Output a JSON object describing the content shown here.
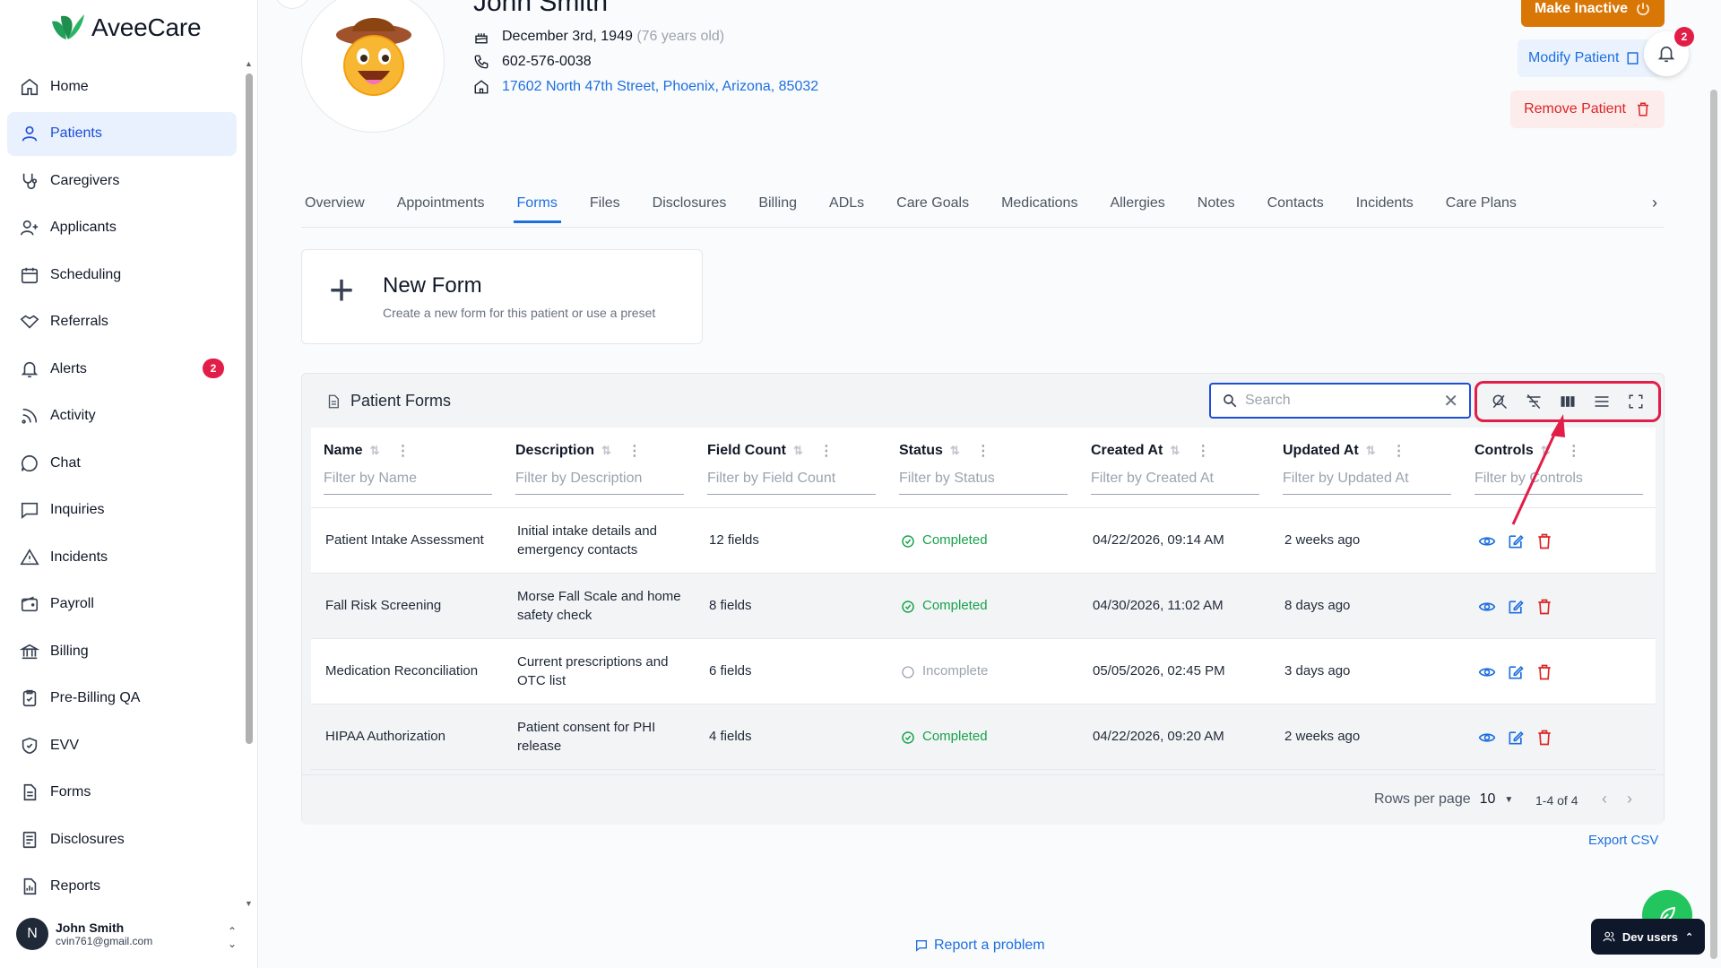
{
  "app": {
    "name": "AveeCare"
  },
  "sidebar": {
    "items": [
      {
        "label": "Home",
        "icon": "home-icon"
      },
      {
        "label": "Patients",
        "icon": "user-icon",
        "active": true
      },
      {
        "label": "Caregivers",
        "icon": "stethoscope-icon"
      },
      {
        "label": "Applicants",
        "icon": "user-plus-icon"
      },
      {
        "label": "Scheduling",
        "icon": "calendar-icon"
      },
      {
        "label": "Referrals",
        "icon": "handshake-icon"
      },
      {
        "label": "Alerts",
        "icon": "bell-icon",
        "badge": "2"
      },
      {
        "label": "Activity",
        "icon": "rss-icon"
      },
      {
        "label": "Chat",
        "icon": "chat-icon"
      },
      {
        "label": "Inquiries",
        "icon": "message-square-icon"
      },
      {
        "label": "Incidents",
        "icon": "warning-icon"
      },
      {
        "label": "Payroll",
        "icon": "wallet-icon"
      },
      {
        "label": "Billing",
        "icon": "bank-icon"
      },
      {
        "label": "Pre-Billing QA",
        "icon": "clipboard-check-icon"
      },
      {
        "label": "EVV",
        "icon": "shield-check-icon"
      },
      {
        "label": "Forms",
        "icon": "document-icon"
      },
      {
        "label": "Disclosures",
        "icon": "document-list-icon"
      },
      {
        "label": "Reports",
        "icon": "report-icon"
      }
    ],
    "user": {
      "initial": "N",
      "name": "John Smith",
      "email": "cvin761@gmail.com"
    }
  },
  "patient": {
    "name": "John Smith",
    "dob": "December 3rd, 1949",
    "age": "(76 years old)",
    "phone": "602-576-0038",
    "address": "17602 North 47th Street, Phoenix, Arizona, 85032"
  },
  "actions": {
    "make_inactive": "Make Inactive",
    "modify": "Modify Patient",
    "remove": "Remove Patient",
    "notifications_badge": "2"
  },
  "tabs": [
    "Overview",
    "Appointments",
    "Forms",
    "Files",
    "Disclosures",
    "Billing",
    "ADLs",
    "Care Goals",
    "Medications",
    "Allergies",
    "Notes",
    "Contacts",
    "Incidents",
    "Care Plans"
  ],
  "active_tab": "Forms",
  "new_form": {
    "title": "New Form",
    "subtitle": "Create a new form for this patient or use a preset"
  },
  "forms_table": {
    "title": "Patient Forms",
    "search_placeholder": "Search",
    "columns": [
      {
        "label": "Name",
        "filter": "Filter by Name"
      },
      {
        "label": "Description",
        "filter": "Filter by Description"
      },
      {
        "label": "Field Count",
        "filter": "Filter by Field Count"
      },
      {
        "label": "Status",
        "filter": "Filter by Status"
      },
      {
        "label": "Created At",
        "filter": "Filter by Created At"
      },
      {
        "label": "Updated At",
        "filter": "Filter by Updated At"
      },
      {
        "label": "Controls",
        "filter": "Filter by Controls"
      }
    ],
    "rows": [
      {
        "name": "Patient Intake Assessment",
        "description": "Initial intake details and emergency contacts",
        "fields": "12 fields",
        "status": "Completed",
        "created": "04/22/2026, 09:14 AM",
        "updated": "2 weeks ago"
      },
      {
        "name": "Fall Risk Screening",
        "description": "Morse Fall Scale and home safety check",
        "fields": "8 fields",
        "status": "Completed",
        "created": "04/30/2026, 11:02 AM",
        "updated": "8 days ago"
      },
      {
        "name": "Medication Reconciliation",
        "description": "Current prescriptions and OTC list",
        "fields": "6 fields",
        "status": "Incomplete",
        "created": "05/05/2026, 02:45 PM",
        "updated": "3 days ago"
      },
      {
        "name": "HIPAA Authorization",
        "description": "Patient consent for PHI release",
        "fields": "4 fields",
        "status": "Completed",
        "created": "04/22/2026, 09:20 AM",
        "updated": "2 weeks ago"
      }
    ],
    "rows_per_page_label": "Rows per page",
    "rows_per_page": "10",
    "range": "1-4 of 4",
    "export": "Export CSV"
  },
  "footer": {
    "report": "Report a problem",
    "dev_users": "Dev users"
  },
  "colors": {
    "primary": "#1d6fe0",
    "warning": "#d97706",
    "danger": "#dc2626",
    "success": "#16a34a",
    "highlight": "#e11d48"
  }
}
